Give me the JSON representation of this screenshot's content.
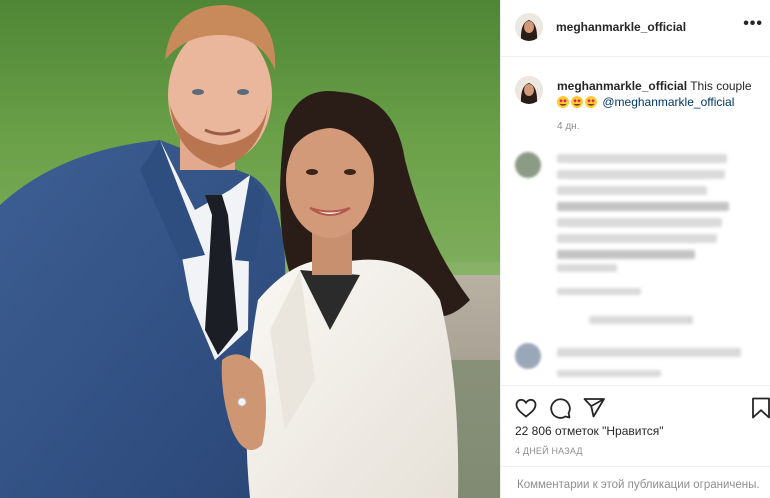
{
  "post": {
    "username": "meghanmarkle_official",
    "more_label": "•••",
    "caption": {
      "username": "meghanmarkle_official",
      "text": "This couple",
      "emojis": [
        "heart-eyes-emoji",
        "heart-eyes-emoji",
        "heart-eyes-emoji"
      ],
      "mention": "@meghanmarkle_official",
      "time": "4 дн."
    },
    "likes": "22 806 отметок \"Нравится\"",
    "date": "4 ДНЕЙ НАЗАД",
    "comments_restricted": "Комментарии к этой публикации ограничены."
  },
  "icons": {
    "more": "more-options-icon",
    "like": "heart-icon",
    "comment": "comment-icon",
    "share": "share-icon",
    "save": "bookmark-icon"
  },
  "colors": {
    "text": "#262626",
    "secondary": "#8e8e8e",
    "link": "#00376b",
    "border": "#efefef"
  }
}
